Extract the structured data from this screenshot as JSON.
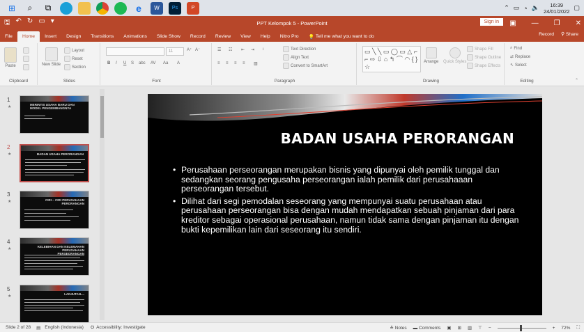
{
  "taskbar": {
    "icons": [
      "windows-start",
      "search",
      "task-view",
      "edge",
      "explorer",
      "chrome",
      "spotify",
      "edge-e",
      "word",
      "photoshop",
      "powerpoint"
    ],
    "time": "16:39",
    "date": "24/01/2022"
  },
  "window": {
    "title": "PPT Kelompok 5  -  PowerPoint",
    "sign_in": "Sign in"
  },
  "tabs": [
    "File",
    "Home",
    "Insert",
    "Design",
    "Transitions",
    "Animations",
    "Slide Show",
    "Record",
    "Review",
    "View",
    "Help",
    "Nitro Pro"
  ],
  "active_tab": "Home",
  "tell_me": "Tell me what you want to do",
  "record_btn": "Record",
  "share_btn": "Share",
  "ribbon": {
    "clipboard": {
      "paste": "Paste",
      "label": "Clipboard"
    },
    "slides": {
      "new_slide": "New Slide",
      "layout": "Layout",
      "reset": "Reset",
      "section": "Section",
      "label": "Slides"
    },
    "font": {
      "label": "Font",
      "size": "11"
    },
    "paragraph": {
      "text_direction": "Text Direction",
      "align_text": "Align Text",
      "convert": "Convert to SmartArt",
      "label": "Paragraph"
    },
    "drawing": {
      "arrange": "Arrange",
      "quick_styles": "Quick Styles",
      "shape_fill": "Shape Fill",
      "shape_outline": "Shape Outline",
      "shape_effects": "Shape Effects",
      "label": "Drawing"
    },
    "editing": {
      "find": "Find",
      "replace": "Replace",
      "select": "Select",
      "label": "Editing"
    }
  },
  "thumbnails": [
    {
      "num": "1",
      "title": "MERINTIS USAHA BARU DAN MODEL PENGEMBANGNYA"
    },
    {
      "num": "2",
      "title": "BADAN USAHA PERORANGAN"
    },
    {
      "num": "3",
      "title": "CIRI – CIRI PERUSAHAAN PERORANGAN"
    },
    {
      "num": "4",
      "title": "KELEBIHAN DAN KELEMAHAN PERUSAHAAN PERSEORANGAN"
    },
    {
      "num": "5",
      "title": "LANJUTAN...."
    }
  ],
  "slide": {
    "title": "BADAN USAHA PERORANGAN",
    "bullet1": "Perusahaan perseorangan merupakan bisnis yang dipunyai oleh pemilik tunggal dan sedangkan seorang pengusaha perseorangan ialah pemilik dari perusahaaan perseorangan tersebut.",
    "bullet2": "Dilihat dari segi pemodalan seseorang yang mempunyai suatu perusahaan atau perusahaan perseorangan bisa dengan mudah mendapatkan sebuah pinjaman dari para kreditor sebagai operasional perusahaan, namun tidak sama dengan pinjaman itu dengan bukti kepemilikan lain dari seseorang itu sendiri."
  },
  "status": {
    "slide_of": "Slide 2 of 28",
    "language": "English (Indonesia)",
    "accessibility": "Accessibility: Investigate",
    "notes": "Notes",
    "comments": "Comments",
    "zoom": "72%"
  },
  "colors": {
    "brand": "#b7472a",
    "slide_bg": "#000000",
    "underline": "#e03a3a"
  }
}
